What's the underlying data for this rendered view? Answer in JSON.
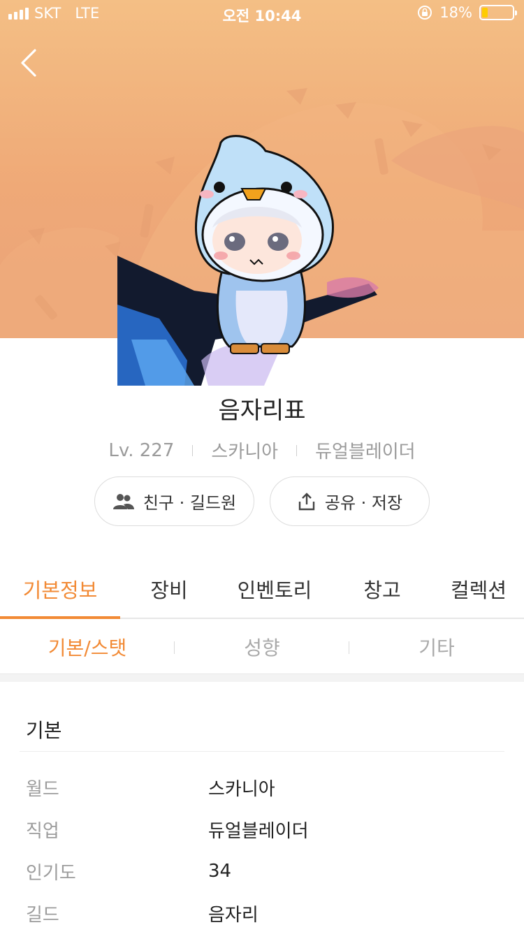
{
  "status_bar": {
    "carrier": "SKT",
    "network": "LTE",
    "time": "오전 10:44",
    "battery_percent": "18%",
    "battery_level": 0.18,
    "battery_color": "#ffcc00"
  },
  "profile": {
    "name": "음자리표",
    "level": "Lv. 227",
    "world": "스카니아",
    "job": "듀얼블레이더"
  },
  "buttons": {
    "friends_label": "친구 · 길드원",
    "share_label": "공유 · 저장"
  },
  "main_tabs": [
    {
      "label": "기본정보",
      "active": true
    },
    {
      "label": "장비",
      "active": false
    },
    {
      "label": "인벤토리",
      "active": false
    },
    {
      "label": "창고",
      "active": false
    },
    {
      "label": "컬렉션",
      "active": false
    }
  ],
  "sub_tabs": [
    {
      "label": "기본/스탯",
      "active": true
    },
    {
      "label": "성향",
      "active": false
    },
    {
      "label": "기타",
      "active": false
    }
  ],
  "section": {
    "title": "기본",
    "rows": [
      {
        "label": "월드",
        "value": "스카니아"
      },
      {
        "label": "직업",
        "value": "듀얼블레이더"
      },
      {
        "label": "인기도",
        "value": "34"
      },
      {
        "label": "길드",
        "value": "음자리"
      }
    ]
  },
  "colors": {
    "accent": "#f28a35",
    "hero_bg": "#efa977"
  }
}
